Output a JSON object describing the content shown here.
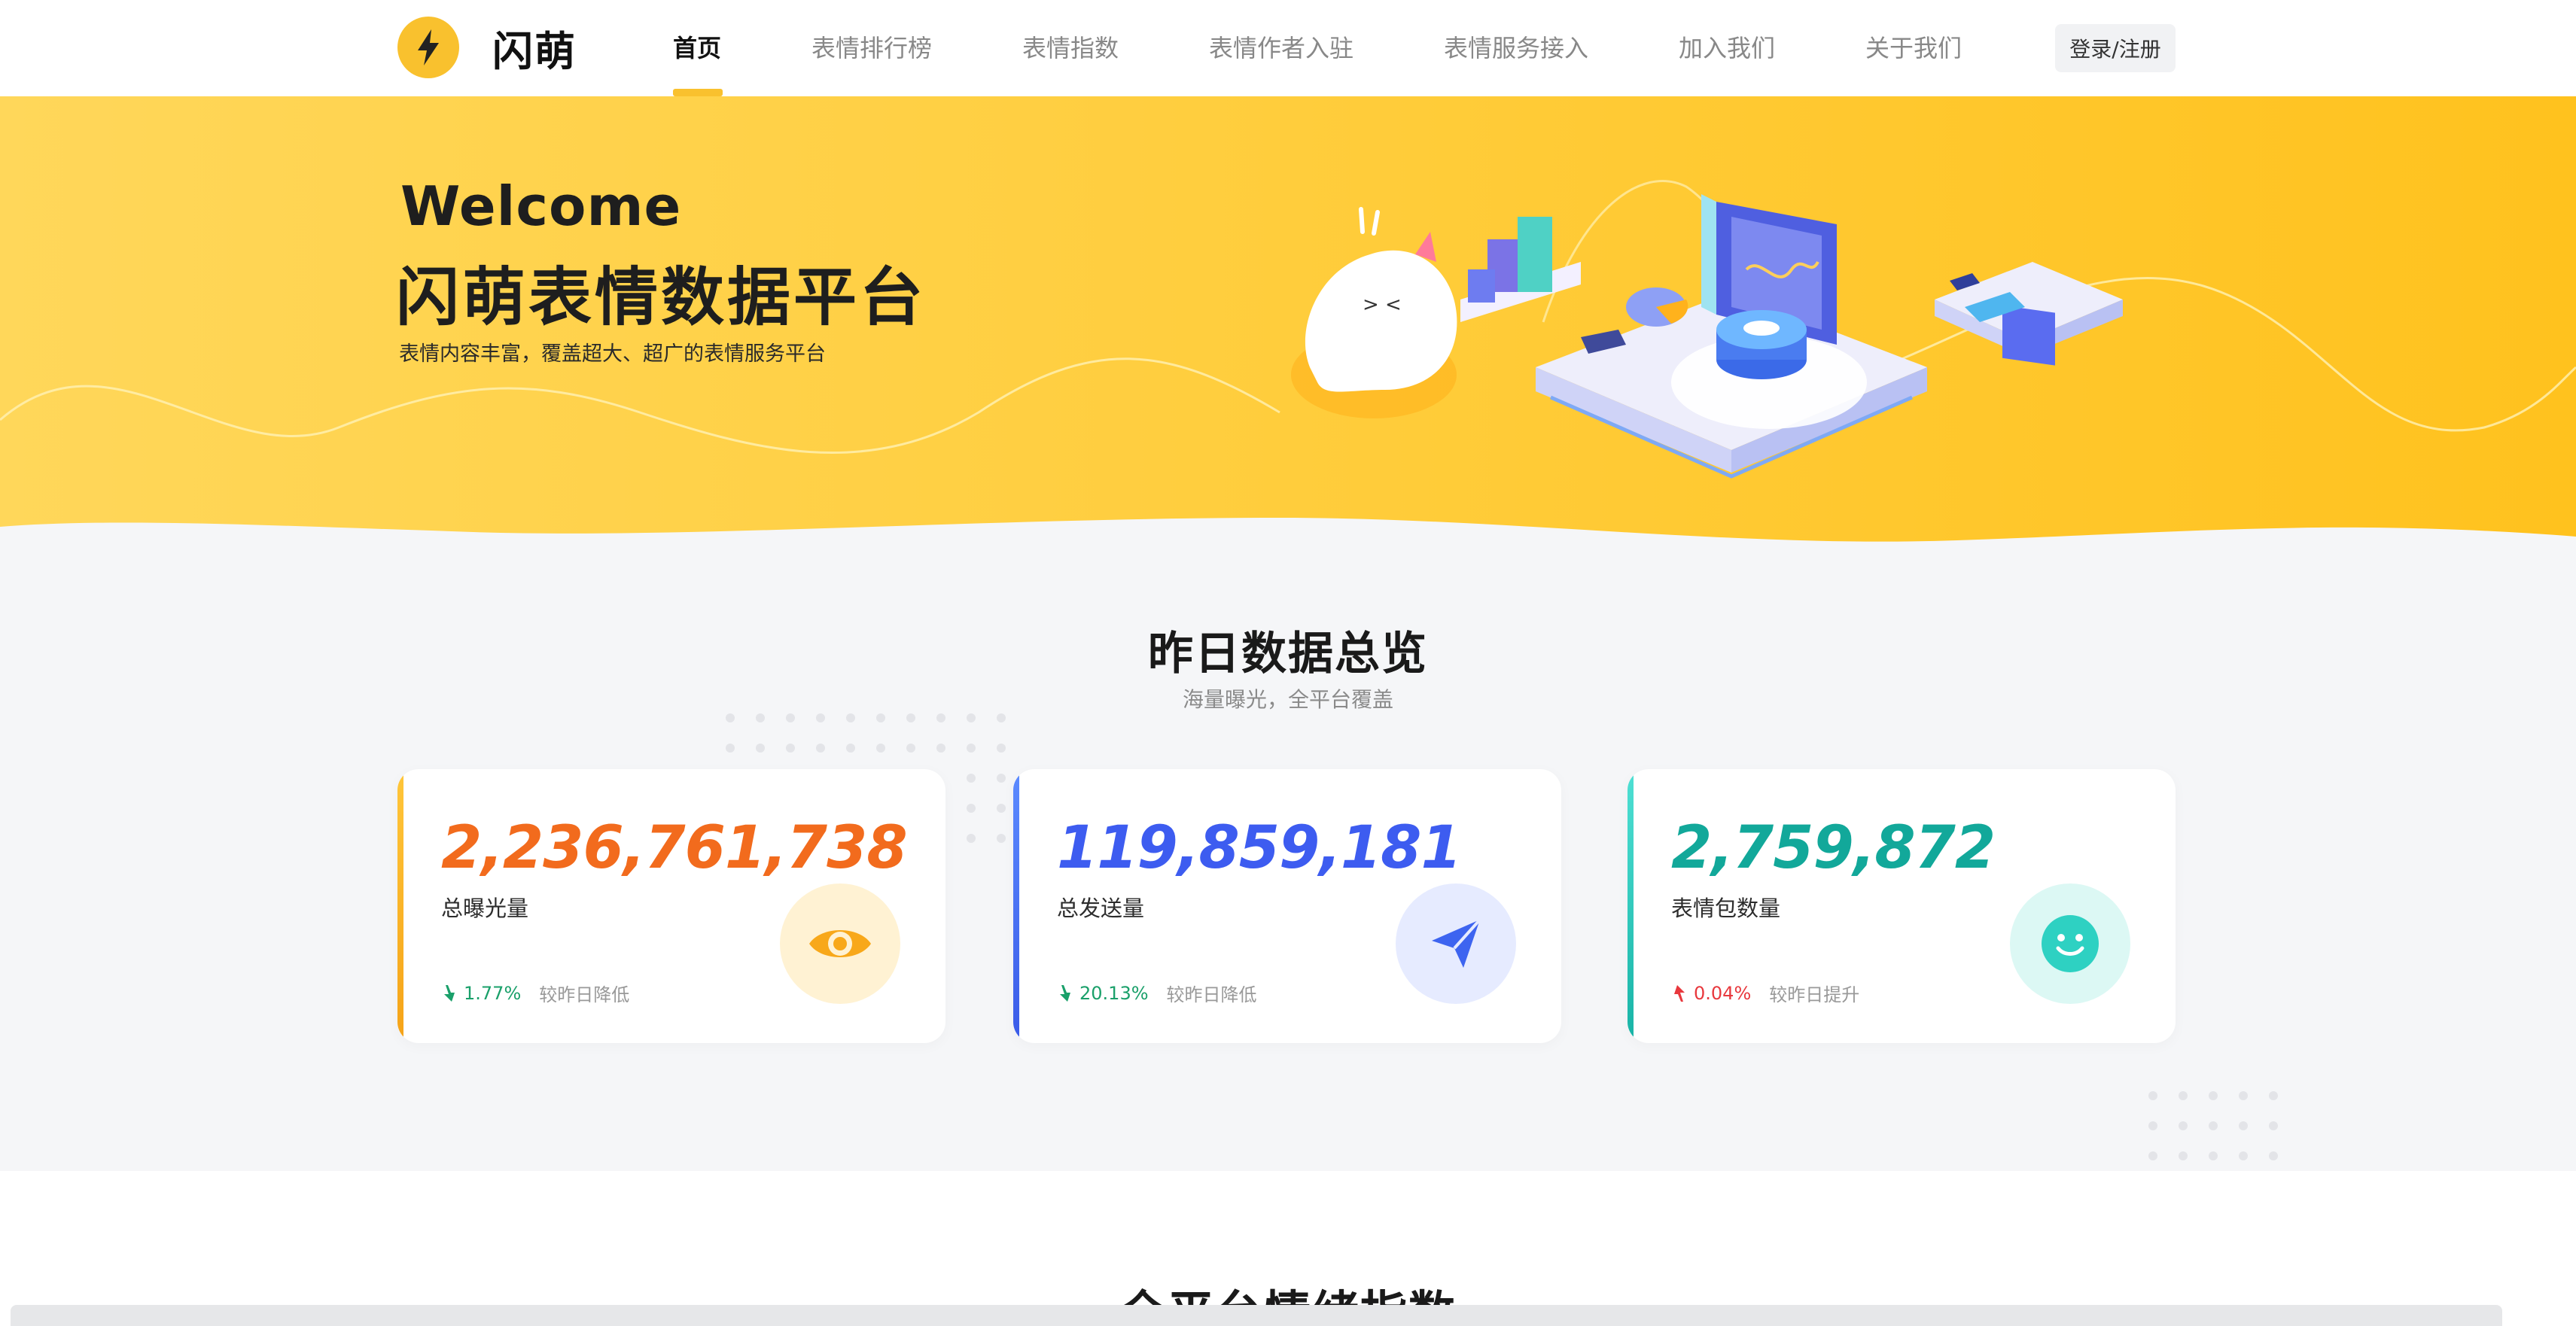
{
  "nav": {
    "logo_text": "闪萌",
    "items": [
      "首页",
      "表情排行榜",
      "表情指数",
      "表情作者入驻",
      "表情服务接入",
      "加入我们",
      "关于我们"
    ],
    "login_label": "登录/注册"
  },
  "hero": {
    "welcome": "Welcome",
    "title": "闪萌表情数据平台",
    "subtitle": "表情内容丰富，覆盖超大、超广的表情服务平台"
  },
  "overview": {
    "title": "昨日数据总览",
    "subtitle": "海量曝光，全平台覆盖",
    "cards": [
      {
        "value": "2,236,761,738",
        "label": "总曝光量",
        "trend": "down",
        "pct": "1.77%",
        "desc": "较昨日降低",
        "color": "#f26b1d",
        "icon": "eye-icon"
      },
      {
        "value": "119,859,181",
        "label": "总发送量",
        "trend": "down",
        "pct": "20.13%",
        "desc": "较昨日降低",
        "color": "#3d5cf0",
        "icon": "send-icon"
      },
      {
        "value": "2,759,872",
        "label": "表情包数量",
        "trend": "up",
        "pct": "0.04%",
        "desc": "较昨日提升",
        "color": "#12a89a",
        "icon": "smile-icon"
      }
    ]
  },
  "section2": {
    "title": "全平台情绪指数"
  },
  "colors": {
    "brand": "#f9c12e",
    "down": "#1aa06a",
    "up": "#e8383d"
  }
}
